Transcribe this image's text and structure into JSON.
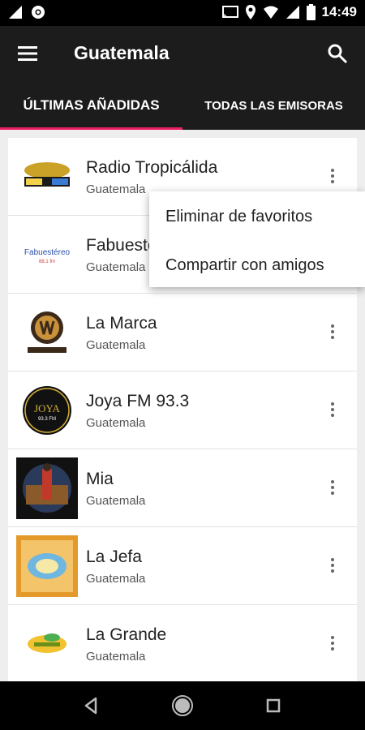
{
  "status_bar": {
    "time": "14:49",
    "left_icons": [
      "signal-icon",
      "chrome-icon"
    ],
    "right_icons": [
      "cast-icon",
      "location-icon",
      "wifi-icon",
      "signal-icon",
      "battery-icon"
    ]
  },
  "app_bar": {
    "title": "Guatemala"
  },
  "tabs": [
    {
      "label": "ÚLTIMAS AÑADIDAS",
      "selected": true
    },
    {
      "label": "TODAS LAS EMISORAS",
      "selected": false
    }
  ],
  "stations": [
    {
      "name": "Radio Tropicálida",
      "country": "Guatemala"
    },
    {
      "name": "Fabuestéreo",
      "country": "Guatemala"
    },
    {
      "name": "La Marca",
      "country": "Guatemala"
    },
    {
      "name": "Joya FM 93.3",
      "country": "Guatemala"
    },
    {
      "name": "Mia",
      "country": "Guatemala"
    },
    {
      "name": "La Jefa",
      "country": "Guatemala"
    },
    {
      "name": "La Grande",
      "country": "Guatemala"
    }
  ],
  "logos": {
    "joya": {
      "brand": "JOYA",
      "freq": "93.3 FM"
    },
    "fabuestereo": {
      "brand": "Fabuestéreo",
      "freq": "88.1 fm"
    }
  },
  "context_menu": {
    "items": [
      "Eliminar de favoritos",
      "Compartir con amigos"
    ]
  },
  "colors": {
    "appbar": "#1c1c1c",
    "tab_indicator": "#e91e63",
    "status_bar": "#000000"
  }
}
